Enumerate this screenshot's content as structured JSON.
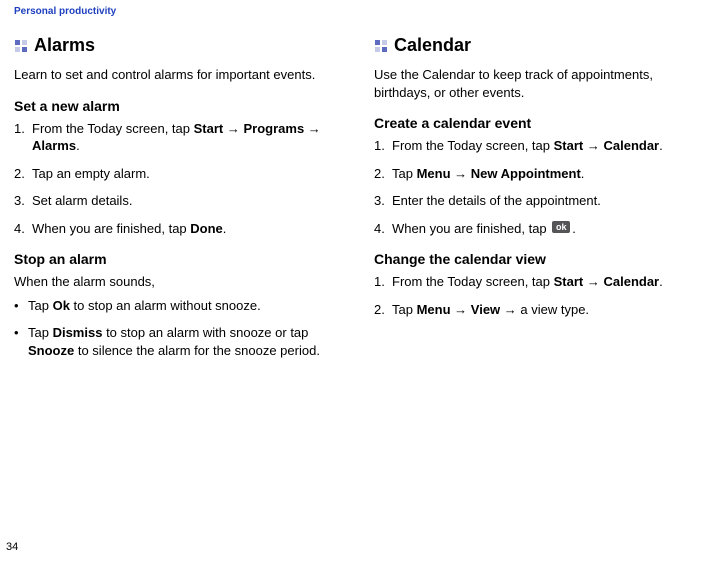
{
  "header": {
    "breadcrumb": "Personal productivity"
  },
  "left": {
    "title": "Alarms",
    "intro": "Learn to set and control alarms for important events.",
    "sectionA": {
      "heading": "Set a new alarm",
      "step1_prefix": "From the Today screen, tap ",
      "step1_bold1": "Start",
      "step1_arrow": " → ",
      "step1_bold2": "Programs",
      "step1_arrow2": " → ",
      "step1_bold3": "Alarms",
      "step2": "Tap an empty alarm.",
      "step3": "Set alarm details.",
      "step4_prefix": "When you are finished, tap ",
      "step4_bold": "Done"
    },
    "sectionB": {
      "heading": "Stop an alarm",
      "lead": "When the alarm sounds,",
      "b1_prefix": "Tap ",
      "b1_bold": "Ok",
      "b1_suffix": " to stop an alarm without snooze.",
      "b2_prefix": "Tap ",
      "b2_bold1": "Dismiss",
      "b2_mid": " to stop an alarm with snooze or tap ",
      "b2_bold2": "Snooze",
      "b2_suffix": " to silence the alarm for the snooze period."
    }
  },
  "right": {
    "title": "Calendar",
    "intro": "Use the Calendar to keep track of appointments, birthdays, or other events.",
    "sectionA": {
      "heading": "Create a calendar event",
      "step1_prefix": "From the Today screen, tap ",
      "step1_bold1": "Start",
      "step1_arrow": " → ",
      "step1_bold2": "Calendar",
      "step2_prefix": "Tap ",
      "step2_bold1": "Menu",
      "step2_arrow": " → ",
      "step2_bold2": "New Appointment",
      "step3": "Enter the details of the appointment.",
      "step4_prefix": "When you are finished, tap ",
      "step4_ok": "ok"
    },
    "sectionB": {
      "heading": "Change the calendar view",
      "step1_prefix": "From the Today screen, tap ",
      "step1_bold1": "Start",
      "step1_arrow": " → ",
      "step1_bold2": "Calendar",
      "step2_prefix": "Tap ",
      "step2_bold1": "Menu",
      "step2_arrow": " → ",
      "step2_bold2": "View",
      "step2_arrow2": " → ",
      "step2_suffix": "a view type."
    }
  },
  "page_number": "34",
  "period": "."
}
